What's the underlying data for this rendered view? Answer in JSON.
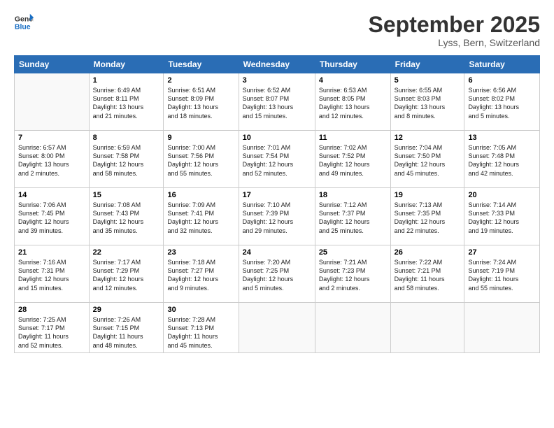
{
  "header": {
    "logo_line1": "General",
    "logo_line2": "Blue",
    "title": "September 2025",
    "subtitle": "Lyss, Bern, Switzerland"
  },
  "columns": [
    "Sunday",
    "Monday",
    "Tuesday",
    "Wednesday",
    "Thursday",
    "Friday",
    "Saturday"
  ],
  "weeks": [
    [
      {
        "day": "",
        "info": ""
      },
      {
        "day": "1",
        "info": "Sunrise: 6:49 AM\nSunset: 8:11 PM\nDaylight: 13 hours\nand 21 minutes."
      },
      {
        "day": "2",
        "info": "Sunrise: 6:51 AM\nSunset: 8:09 PM\nDaylight: 13 hours\nand 18 minutes."
      },
      {
        "day": "3",
        "info": "Sunrise: 6:52 AM\nSunset: 8:07 PM\nDaylight: 13 hours\nand 15 minutes."
      },
      {
        "day": "4",
        "info": "Sunrise: 6:53 AM\nSunset: 8:05 PM\nDaylight: 13 hours\nand 12 minutes."
      },
      {
        "day": "5",
        "info": "Sunrise: 6:55 AM\nSunset: 8:03 PM\nDaylight: 13 hours\nand 8 minutes."
      },
      {
        "day": "6",
        "info": "Sunrise: 6:56 AM\nSunset: 8:02 PM\nDaylight: 13 hours\nand 5 minutes."
      }
    ],
    [
      {
        "day": "7",
        "info": "Sunrise: 6:57 AM\nSunset: 8:00 PM\nDaylight: 13 hours\nand 2 minutes."
      },
      {
        "day": "8",
        "info": "Sunrise: 6:59 AM\nSunset: 7:58 PM\nDaylight: 12 hours\nand 58 minutes."
      },
      {
        "day": "9",
        "info": "Sunrise: 7:00 AM\nSunset: 7:56 PM\nDaylight: 12 hours\nand 55 minutes."
      },
      {
        "day": "10",
        "info": "Sunrise: 7:01 AM\nSunset: 7:54 PM\nDaylight: 12 hours\nand 52 minutes."
      },
      {
        "day": "11",
        "info": "Sunrise: 7:02 AM\nSunset: 7:52 PM\nDaylight: 12 hours\nand 49 minutes."
      },
      {
        "day": "12",
        "info": "Sunrise: 7:04 AM\nSunset: 7:50 PM\nDaylight: 12 hours\nand 45 minutes."
      },
      {
        "day": "13",
        "info": "Sunrise: 7:05 AM\nSunset: 7:48 PM\nDaylight: 12 hours\nand 42 minutes."
      }
    ],
    [
      {
        "day": "14",
        "info": "Sunrise: 7:06 AM\nSunset: 7:45 PM\nDaylight: 12 hours\nand 39 minutes."
      },
      {
        "day": "15",
        "info": "Sunrise: 7:08 AM\nSunset: 7:43 PM\nDaylight: 12 hours\nand 35 minutes."
      },
      {
        "day": "16",
        "info": "Sunrise: 7:09 AM\nSunset: 7:41 PM\nDaylight: 12 hours\nand 32 minutes."
      },
      {
        "day": "17",
        "info": "Sunrise: 7:10 AM\nSunset: 7:39 PM\nDaylight: 12 hours\nand 29 minutes."
      },
      {
        "day": "18",
        "info": "Sunrise: 7:12 AM\nSunset: 7:37 PM\nDaylight: 12 hours\nand 25 minutes."
      },
      {
        "day": "19",
        "info": "Sunrise: 7:13 AM\nSunset: 7:35 PM\nDaylight: 12 hours\nand 22 minutes."
      },
      {
        "day": "20",
        "info": "Sunrise: 7:14 AM\nSunset: 7:33 PM\nDaylight: 12 hours\nand 19 minutes."
      }
    ],
    [
      {
        "day": "21",
        "info": "Sunrise: 7:16 AM\nSunset: 7:31 PM\nDaylight: 12 hours\nand 15 minutes."
      },
      {
        "day": "22",
        "info": "Sunrise: 7:17 AM\nSunset: 7:29 PM\nDaylight: 12 hours\nand 12 minutes."
      },
      {
        "day": "23",
        "info": "Sunrise: 7:18 AM\nSunset: 7:27 PM\nDaylight: 12 hours\nand 9 minutes."
      },
      {
        "day": "24",
        "info": "Sunrise: 7:20 AM\nSunset: 7:25 PM\nDaylight: 12 hours\nand 5 minutes."
      },
      {
        "day": "25",
        "info": "Sunrise: 7:21 AM\nSunset: 7:23 PM\nDaylight: 12 hours\nand 2 minutes."
      },
      {
        "day": "26",
        "info": "Sunrise: 7:22 AM\nSunset: 7:21 PM\nDaylight: 11 hours\nand 58 minutes."
      },
      {
        "day": "27",
        "info": "Sunrise: 7:24 AM\nSunset: 7:19 PM\nDaylight: 11 hours\nand 55 minutes."
      }
    ],
    [
      {
        "day": "28",
        "info": "Sunrise: 7:25 AM\nSunset: 7:17 PM\nDaylight: 11 hours\nand 52 minutes."
      },
      {
        "day": "29",
        "info": "Sunrise: 7:26 AM\nSunset: 7:15 PM\nDaylight: 11 hours\nand 48 minutes."
      },
      {
        "day": "30",
        "info": "Sunrise: 7:28 AM\nSunset: 7:13 PM\nDaylight: 11 hours\nand 45 minutes."
      },
      {
        "day": "",
        "info": ""
      },
      {
        "day": "",
        "info": ""
      },
      {
        "day": "",
        "info": ""
      },
      {
        "day": "",
        "info": ""
      }
    ]
  ]
}
